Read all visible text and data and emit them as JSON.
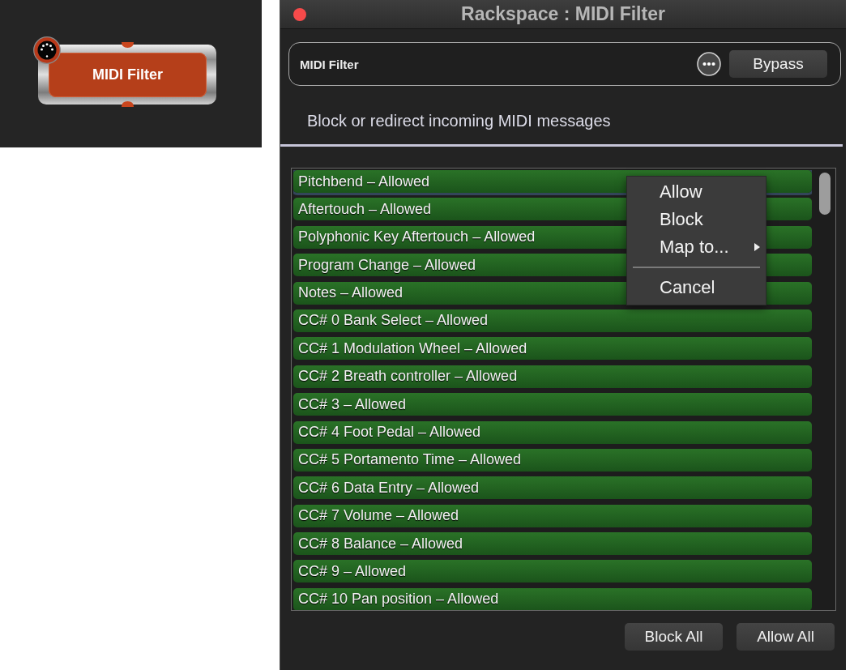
{
  "canvas": {
    "plugin": {
      "label": "MIDI Filter"
    }
  },
  "window": {
    "title": "Rackspace : MIDI Filter"
  },
  "header": {
    "plugin_name": "MIDI Filter",
    "bypass_button": "Bypass"
  },
  "description": "Block or redirect incoming MIDI messages",
  "rows": [
    {
      "label": "Pitchbend – Allowed",
      "selected": true
    },
    {
      "label": "Aftertouch – Allowed",
      "selected": false
    },
    {
      "label": "Polyphonic Key Aftertouch – Allowed",
      "selected": false
    },
    {
      "label": "Program Change – Allowed",
      "selected": false
    },
    {
      "label": "Notes – Allowed",
      "selected": false
    },
    {
      "label": "CC# 0 Bank Select – Allowed",
      "selected": false
    },
    {
      "label": "CC# 1 Modulation Wheel – Allowed",
      "selected": false
    },
    {
      "label": "CC# 2 Breath controller – Allowed",
      "selected": false
    },
    {
      "label": "CC# 3 – Allowed",
      "selected": false
    },
    {
      "label": "CC# 4 Foot Pedal – Allowed",
      "selected": false
    },
    {
      "label": "CC# 5 Portamento Time – Allowed",
      "selected": false
    },
    {
      "label": "CC# 6 Data Entry – Allowed",
      "selected": false
    },
    {
      "label": "CC# 7 Volume – Allowed",
      "selected": false
    },
    {
      "label": "CC# 8 Balance – Allowed",
      "selected": false
    },
    {
      "label": "CC# 9 – Allowed",
      "selected": false
    },
    {
      "label": "CC# 10 Pan position – Allowed",
      "selected": false
    }
  ],
  "context_menu": {
    "items": [
      {
        "kind": "item",
        "label": "Allow"
      },
      {
        "kind": "item",
        "label": "Block"
      },
      {
        "kind": "submenu",
        "label": "Map to..."
      },
      {
        "kind": "separator"
      },
      {
        "kind": "item",
        "label": "Cancel"
      }
    ]
  },
  "footer_buttons": [
    "Block All",
    "Allow All"
  ]
}
